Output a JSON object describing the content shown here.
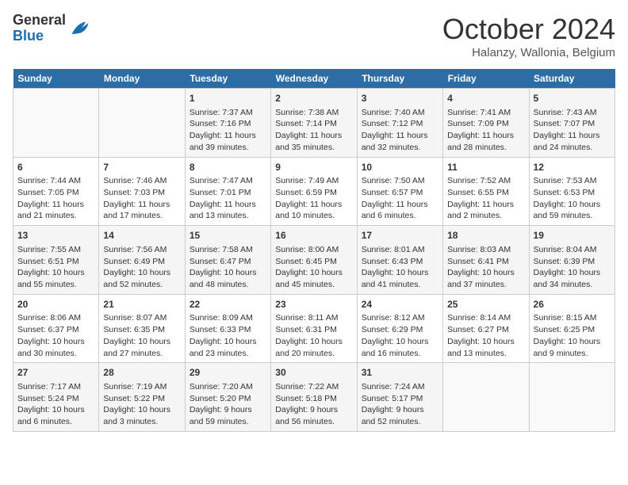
{
  "header": {
    "logo_general": "General",
    "logo_blue": "Blue",
    "month": "October 2024",
    "location": "Halanzy, Wallonia, Belgium"
  },
  "days_of_week": [
    "Sunday",
    "Monday",
    "Tuesday",
    "Wednesday",
    "Thursday",
    "Friday",
    "Saturday"
  ],
  "weeks": [
    [
      {
        "num": "",
        "text": ""
      },
      {
        "num": "",
        "text": ""
      },
      {
        "num": "1",
        "text": "Sunrise: 7:37 AM\nSunset: 7:16 PM\nDaylight: 11 hours and 39 minutes."
      },
      {
        "num": "2",
        "text": "Sunrise: 7:38 AM\nSunset: 7:14 PM\nDaylight: 11 hours and 35 minutes."
      },
      {
        "num": "3",
        "text": "Sunrise: 7:40 AM\nSunset: 7:12 PM\nDaylight: 11 hours and 32 minutes."
      },
      {
        "num": "4",
        "text": "Sunrise: 7:41 AM\nSunset: 7:09 PM\nDaylight: 11 hours and 28 minutes."
      },
      {
        "num": "5",
        "text": "Sunrise: 7:43 AM\nSunset: 7:07 PM\nDaylight: 11 hours and 24 minutes."
      }
    ],
    [
      {
        "num": "6",
        "text": "Sunrise: 7:44 AM\nSunset: 7:05 PM\nDaylight: 11 hours and 21 minutes."
      },
      {
        "num": "7",
        "text": "Sunrise: 7:46 AM\nSunset: 7:03 PM\nDaylight: 11 hours and 17 minutes."
      },
      {
        "num": "8",
        "text": "Sunrise: 7:47 AM\nSunset: 7:01 PM\nDaylight: 11 hours and 13 minutes."
      },
      {
        "num": "9",
        "text": "Sunrise: 7:49 AM\nSunset: 6:59 PM\nDaylight: 11 hours and 10 minutes."
      },
      {
        "num": "10",
        "text": "Sunrise: 7:50 AM\nSunset: 6:57 PM\nDaylight: 11 hours and 6 minutes."
      },
      {
        "num": "11",
        "text": "Sunrise: 7:52 AM\nSunset: 6:55 PM\nDaylight: 11 hours and 2 minutes."
      },
      {
        "num": "12",
        "text": "Sunrise: 7:53 AM\nSunset: 6:53 PM\nDaylight: 10 hours and 59 minutes."
      }
    ],
    [
      {
        "num": "13",
        "text": "Sunrise: 7:55 AM\nSunset: 6:51 PM\nDaylight: 10 hours and 55 minutes."
      },
      {
        "num": "14",
        "text": "Sunrise: 7:56 AM\nSunset: 6:49 PM\nDaylight: 10 hours and 52 minutes."
      },
      {
        "num": "15",
        "text": "Sunrise: 7:58 AM\nSunset: 6:47 PM\nDaylight: 10 hours and 48 minutes."
      },
      {
        "num": "16",
        "text": "Sunrise: 8:00 AM\nSunset: 6:45 PM\nDaylight: 10 hours and 45 minutes."
      },
      {
        "num": "17",
        "text": "Sunrise: 8:01 AM\nSunset: 6:43 PM\nDaylight: 10 hours and 41 minutes."
      },
      {
        "num": "18",
        "text": "Sunrise: 8:03 AM\nSunset: 6:41 PM\nDaylight: 10 hours and 37 minutes."
      },
      {
        "num": "19",
        "text": "Sunrise: 8:04 AM\nSunset: 6:39 PM\nDaylight: 10 hours and 34 minutes."
      }
    ],
    [
      {
        "num": "20",
        "text": "Sunrise: 8:06 AM\nSunset: 6:37 PM\nDaylight: 10 hours and 30 minutes."
      },
      {
        "num": "21",
        "text": "Sunrise: 8:07 AM\nSunset: 6:35 PM\nDaylight: 10 hours and 27 minutes."
      },
      {
        "num": "22",
        "text": "Sunrise: 8:09 AM\nSunset: 6:33 PM\nDaylight: 10 hours and 23 minutes."
      },
      {
        "num": "23",
        "text": "Sunrise: 8:11 AM\nSunset: 6:31 PM\nDaylight: 10 hours and 20 minutes."
      },
      {
        "num": "24",
        "text": "Sunrise: 8:12 AM\nSunset: 6:29 PM\nDaylight: 10 hours and 16 minutes."
      },
      {
        "num": "25",
        "text": "Sunrise: 8:14 AM\nSunset: 6:27 PM\nDaylight: 10 hours and 13 minutes."
      },
      {
        "num": "26",
        "text": "Sunrise: 8:15 AM\nSunset: 6:25 PM\nDaylight: 10 hours and 9 minutes."
      }
    ],
    [
      {
        "num": "27",
        "text": "Sunrise: 7:17 AM\nSunset: 5:24 PM\nDaylight: 10 hours and 6 minutes."
      },
      {
        "num": "28",
        "text": "Sunrise: 7:19 AM\nSunset: 5:22 PM\nDaylight: 10 hours and 3 minutes."
      },
      {
        "num": "29",
        "text": "Sunrise: 7:20 AM\nSunset: 5:20 PM\nDaylight: 9 hours and 59 minutes."
      },
      {
        "num": "30",
        "text": "Sunrise: 7:22 AM\nSunset: 5:18 PM\nDaylight: 9 hours and 56 minutes."
      },
      {
        "num": "31",
        "text": "Sunrise: 7:24 AM\nSunset: 5:17 PM\nDaylight: 9 hours and 52 minutes."
      },
      {
        "num": "",
        "text": ""
      },
      {
        "num": "",
        "text": ""
      }
    ]
  ]
}
